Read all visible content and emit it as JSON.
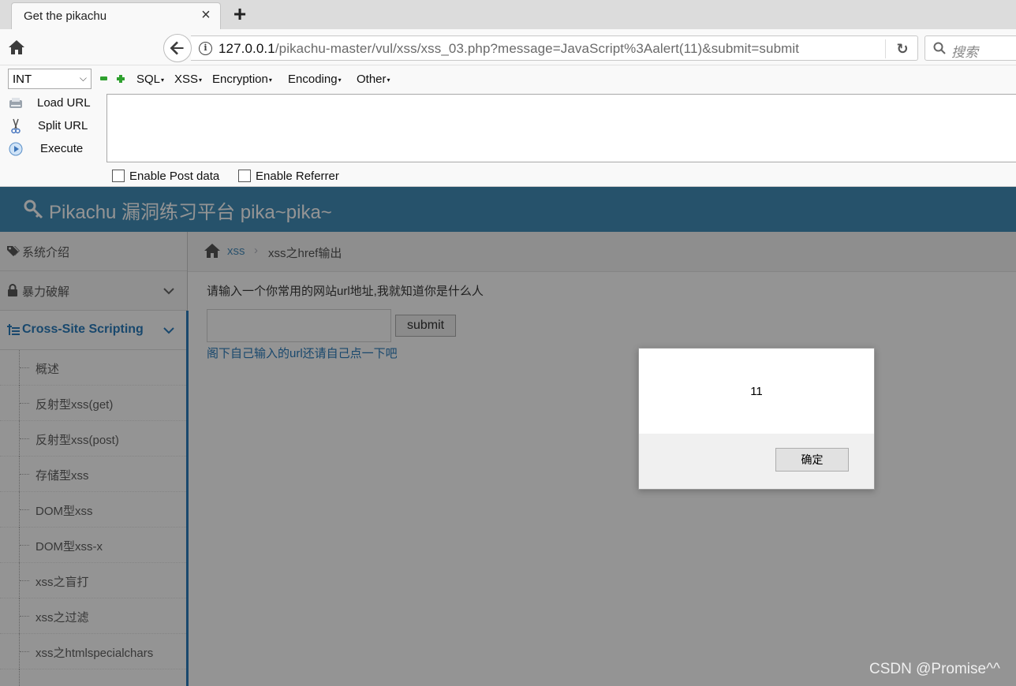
{
  "browser": {
    "tab_title": "Get the pikachu",
    "url_host": "127.0.0.1",
    "url_path": "/pikachu-master/vul/xss/xss_03.php?message=JavaScript%3Aalert(11)&submit=submit",
    "search_placeholder": "搜索"
  },
  "hackbar": {
    "select_value": "INT",
    "menus": [
      "SQL",
      "XSS",
      "Encryption",
      "Encoding",
      "Other"
    ],
    "load_url": "Load URL",
    "split_url": "Split URL",
    "execute": "Execute",
    "post_label": "Enable Post data",
    "referrer_label": "Enable Referrer"
  },
  "site": {
    "title": "Pikachu 漏洞练习平台 pika~pika~"
  },
  "sidebar": {
    "items": [
      "系统介绍",
      "暴力破解",
      "Cross-Site Scripting"
    ],
    "subitems": [
      "概述",
      "反射型xss(get)",
      "反射型xss(post)",
      "存储型xss",
      "DOM型xss",
      "DOM型xss-x",
      "xss之盲打",
      "xss之过滤",
      "xss之htmlspecialchars"
    ]
  },
  "breadcrumb": {
    "link": "xss",
    "sep": "›",
    "current": "xss之href输出"
  },
  "main": {
    "prompt": "请输入一个你常用的网站url地址,我就知道你是什么人",
    "submit_label": "submit",
    "result_link": "阁下自己输入的url还请自己点一下吧"
  },
  "dialog": {
    "message": "11",
    "ok_label": "确定"
  },
  "watermark": "CSDN @Promise^^",
  "colors": {
    "header": "#438eb9",
    "link": "#2b7dbc"
  }
}
